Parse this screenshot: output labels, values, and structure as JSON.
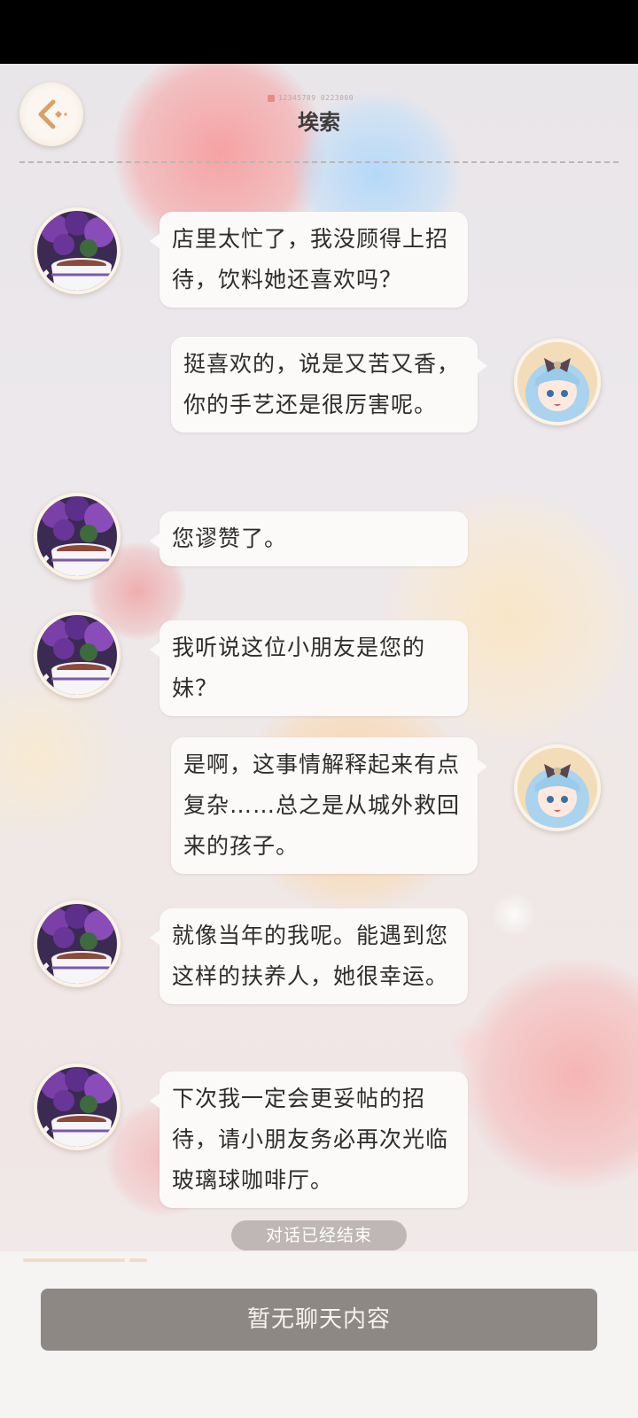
{
  "header": {
    "title": "埃索",
    "signal_text": "12345789 0223000"
  },
  "messages": [
    {
      "side": "left",
      "sender": "埃索",
      "text": "店里太忙了，我没顾得上招待，饮料她还喜欢吗？"
    },
    {
      "side": "right",
      "sender": "player",
      "text": "挺喜欢的，说是又苦又香，你的手艺还是很厉害呢。"
    },
    {
      "side": "left",
      "sender": "埃索",
      "text": "您谬赞了。"
    },
    {
      "side": "left",
      "sender": "埃索",
      "text": "我听说这位小朋友是您的妹？"
    },
    {
      "side": "right",
      "sender": "player",
      "text": "是啊，这事情解释起来有点复杂……总之是从城外救回来的孩子。"
    },
    {
      "side": "left",
      "sender": "埃索",
      "text": "就像当年的我呢。能遇到您这样的扶养人，她很幸运。"
    },
    {
      "side": "left",
      "sender": "埃索",
      "text": "下次我一定会更妥帖的招待，请小朋友务必再次光临玻璃球咖啡厅。"
    }
  ],
  "end_notice": "对话已经结束",
  "footer": {
    "input_placeholder": "暂无聊天内容"
  },
  "icons": {
    "back": "back-arrow-icon",
    "npc_avatar": "coffee-cup-hydrangea-avatar",
    "player_avatar": "blue-haired-girl-avatar"
  },
  "colors": {
    "bubble": "#fbfaf8",
    "text": "#2f2c2c",
    "input_bar": "#8e8884",
    "end_notice_bg": "#968e8a"
  }
}
